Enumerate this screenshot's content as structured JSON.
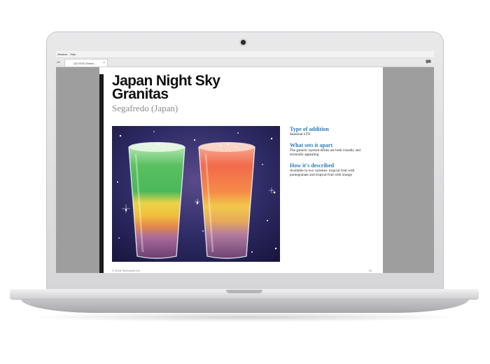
{
  "menu": {
    "items": [
      "Window",
      "Help"
    ]
  },
  "tabs": {
    "side_label": "ols",
    "active_tab": "Q3-2018-Global-...",
    "close_glyph": "×"
  },
  "document": {
    "title_line1": "Japan Night Sky",
    "title_line2": "Granitas",
    "subtitle": "Segafredo (Japan)",
    "sections": [
      {
        "heading": "Type of addition",
        "body": "Seasonal LTO"
      },
      {
        "heading": "What sets it apart",
        "body": "The galactic layered drinks are both visually and texturally appealing"
      },
      {
        "heading": "How it's described",
        "body": "Available in two varieties: tropical fruit with pomegranate and tropical fruit with orange"
      }
    ],
    "footer_copyright": "© 2018 Technomic Inc.",
    "page_number": "29"
  },
  "icons": {
    "comment": "comment-icon"
  },
  "colors": {
    "heading_accent": "#2a7ab8",
    "page_bar": "#1c1c1c",
    "screen_gutter": "#9e9e9e"
  }
}
